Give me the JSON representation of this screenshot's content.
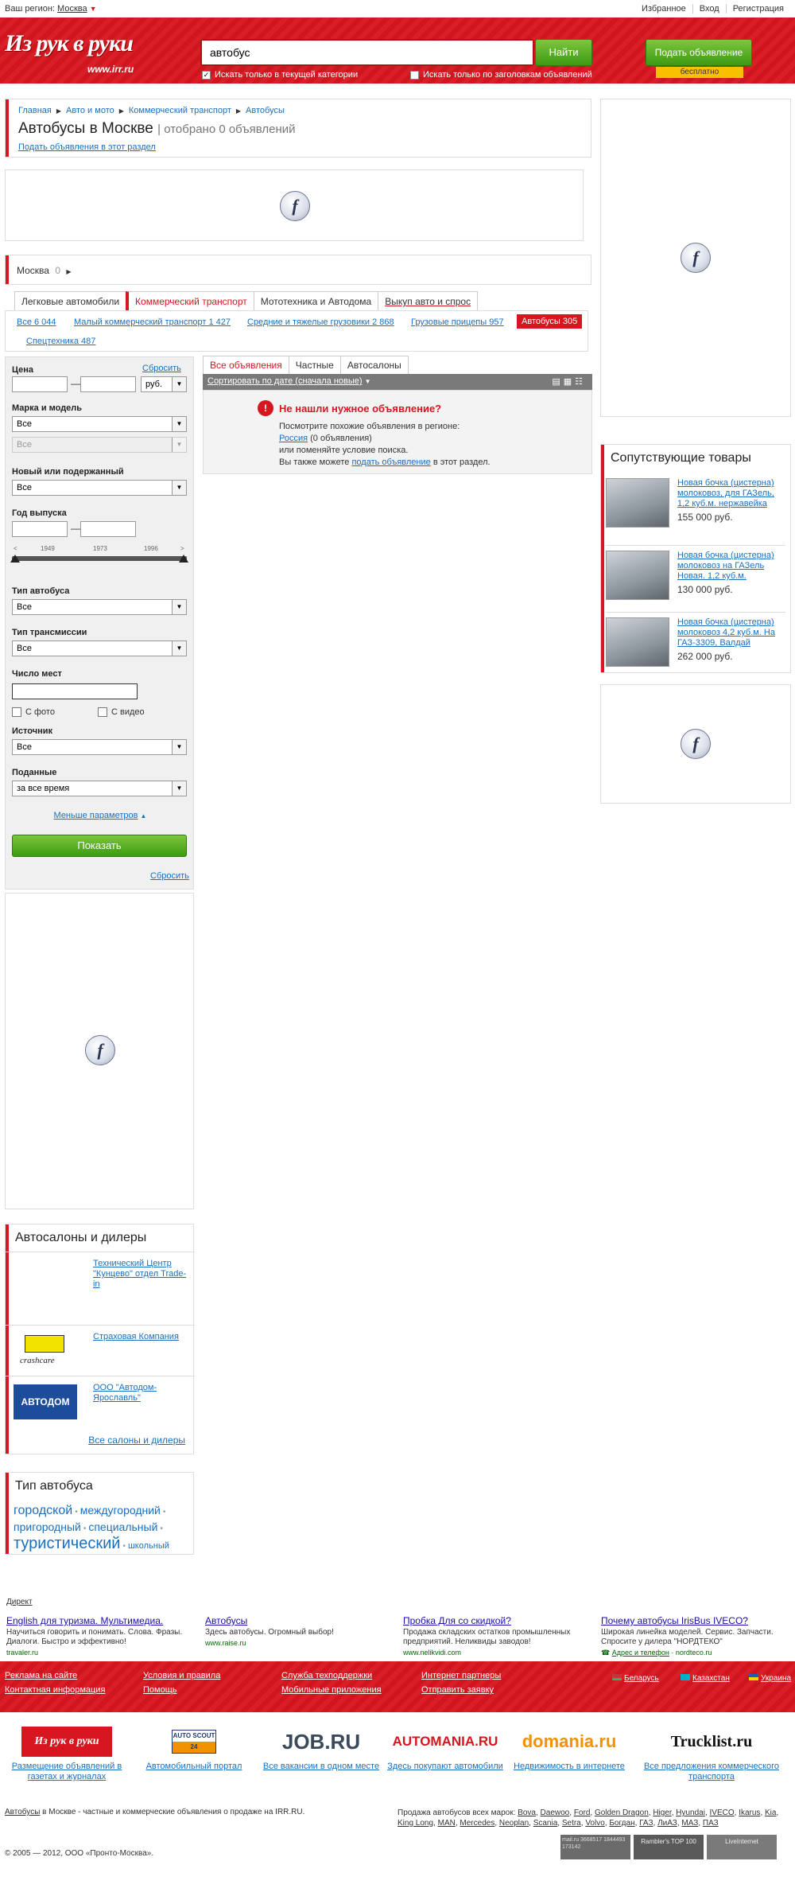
{
  "topbar": {
    "region_label": "Ваш регион:",
    "region_value": "Москва",
    "favorites": "Избранное",
    "login": "Вход",
    "register": "Регистрация"
  },
  "header": {
    "logo": "Из рук в руки",
    "logo_sub": "www.irr.ru",
    "search_value": "автобус",
    "search_button": "Найти",
    "chk_category": "Искать только в текущей категории",
    "chk_titles": "Искать только по заголовкам объявлений",
    "post_button": "Подать объявление",
    "post_free": "бесплатно"
  },
  "breadcrumb": [
    "Главная",
    "Авто и мото",
    "Коммерческий транспорт",
    "Автобусы"
  ],
  "page": {
    "title": "Автобусы в Москве",
    "count": "отобрано 0 объявлений",
    "post_link": "Подать объявления в этот раздел"
  },
  "location": {
    "city": "Москва",
    "count": "0"
  },
  "category_tabs": [
    "Легковые автомобили",
    "Коммерческий транспорт",
    "Мототехника и Автодома",
    "Выкуп авто и спрос"
  ],
  "subcats": [
    {
      "label": "Все 6 044"
    },
    {
      "label": "Малый коммерческий транспорт 1 427"
    },
    {
      "label": "Средние и тяжелые грузовики 2 868"
    },
    {
      "label": "Грузовые прицепы 957"
    },
    {
      "label": "Автобусы 305"
    },
    {
      "label": "Спецтехника 487"
    }
  ],
  "filter": {
    "price": "Цена",
    "reset": "Сбросить",
    "currency": "руб.",
    "brand": "Марка и модель",
    "brand_val": "Все",
    "model_val": "Все",
    "condition": "Новый или подержанный",
    "condition_val": "Все",
    "year": "Год выпуска",
    "ticks": [
      "1949",
      "1973",
      "1996"
    ],
    "bus_type": "Тип автобуса",
    "bus_type_val": "Все",
    "transmission": "Тип трансмиссии",
    "transmission_val": "Все",
    "seats": "Число мест",
    "with_photo": "С фото",
    "with_video": "С видео",
    "source": "Источник",
    "source_val": "Все",
    "posted": "Поданные",
    "posted_val": "за все время",
    "less_params": "Меньше параметров",
    "show_button": "Показать",
    "reset_bottom": "Сбросить"
  },
  "results": {
    "tabs": [
      "Все объявления",
      "Частные",
      "Автосалоны"
    ],
    "sort": "Сортировать по дате (сначала новые)",
    "nf_title": "Не нашли нужное объявление?",
    "nf_line1": "Посмотрите похожие объявления в регионе:",
    "nf_region": "Россия",
    "nf_region_count": "(0 объявления)",
    "nf_line2": "или поменяйте условие поиска.",
    "nf_line3_a": "Вы также можете",
    "nf_line3_link": "подать объявление",
    "nf_line3_b": "в этот раздел."
  },
  "goods": {
    "title": "Сопутствующие товары",
    "items": [
      {
        "title": "Новая бочка (цистерна) молоковоз, для ГАЗель, 1,2 куб.м. нержавейка",
        "price": "155 000 руб."
      },
      {
        "title": "Новая бочка (цистерна) молоковоз на ГАЗель Новая. 1,2 куб.м.",
        "price": "130 000 руб."
      },
      {
        "title": "Новая бочка (цистерна) молоковоз 4,2 куб.м. На ГАЗ-3309, Валдай",
        "price": "262 000 руб."
      }
    ]
  },
  "dealers": {
    "title": "Автосалоны и дилеры",
    "items": [
      {
        "name": "Технический Центр \"Кунцево\" отдел Trade-in"
      },
      {
        "name": "Страховая Компания"
      },
      {
        "name": "ООО \"Автодом-Ярославль\""
      }
    ],
    "logo2_text": "crashcare",
    "logo3_text": "АВТОДОМ",
    "all_link": "Все салоны и дилеры"
  },
  "bus_types": {
    "title": "Тип автобуса",
    "tags": [
      "городской",
      "междугородний",
      "пригородный",
      "специальный",
      "туристический",
      "школьный"
    ]
  },
  "direct": {
    "label": "Директ",
    "ads": [
      {
        "title": "English для туризма. Мультимедиа.",
        "text": "Научиться говорить и понимать. Слова. Фразы. Диалоги. Быстро и эффективно!",
        "site": "travaler.ru"
      },
      {
        "title": "Автобусы",
        "text": "Здесь автобусы. Огромный выбор!",
        "site": "www.raise.ru"
      },
      {
        "title": "Пробка Для со скидкой?",
        "text": "Продажа складских остатков промышленных предприятий. Неликвиды заводов!",
        "site": "www.nelikvidi.com"
      },
      {
        "title": "Почему автобусы IrisBus IVECO?",
        "text": "Широкая линейка моделей. Сервис. Запчасти. Спросите у дилера \"НОРДТЕКО\"",
        "site": "nordteco.ru",
        "extra": "Адрес и телефон"
      }
    ]
  },
  "footer": {
    "links1": [
      "Реклама на сайте",
      "Контактная информация"
    ],
    "links2": [
      "Условия и правила",
      "Помощь"
    ],
    "links3": [
      "Служба техподдержки",
      "Мобильные приложения"
    ],
    "links4": [
      "Интернет партнеры",
      "Отправить заявку"
    ],
    "countries": [
      "Беларусь",
      "Казахстан",
      "Украина"
    ],
    "partners": [
      {
        "logo": "Из рук в руки",
        "text": "Размещение объявлений в газетах и журналах"
      },
      {
        "logo": "AUTO SCOUT 24",
        "text": "Автомобильный портал"
      },
      {
        "logo": "JOB.RU",
        "text": "Все вакансии в одном месте"
      },
      {
        "logo": "AUTOMANIA.RU",
        "text": "Здесь покупают автомобили"
      },
      {
        "logo": "domania.ru",
        "text": "Недвижимость в интернете"
      },
      {
        "logo": "Trucklist.ru",
        "text": "Все предложения коммерческого транспорта"
      }
    ],
    "seo_link": "Автобусы",
    "seo_text": "в Москве - частные и коммерческие объявления о продаже на IRR.RU.",
    "brands_label": "Продажа автобусов всех марок:",
    "brands": [
      "Bova",
      "Daewoo",
      "Ford",
      "Golden Dragon",
      "Higer",
      "Hyundai",
      "IVECO",
      "Ikarus",
      "Kia",
      "King Long",
      "MAN",
      "Mercedes",
      "Neoplan",
      "Scania",
      "Setra",
      "Volvo",
      "Богдан",
      "ГАЗ",
      "ЛиАЗ",
      "МАЗ",
      "ПАЗ"
    ],
    "copyright": "© 2005 — 2012, ООО «Пронто-Москва».",
    "counters": [
      "mail.ru 3668517 1844493 173142",
      "Rambler's TOP 100",
      "LiveInternet"
    ]
  },
  "colors": {
    "brand_red": "#d7161f",
    "green": "#3e9a12",
    "link": "#1a6fbf"
  }
}
